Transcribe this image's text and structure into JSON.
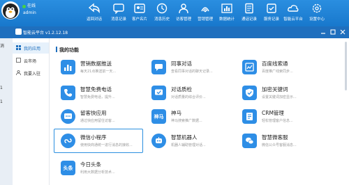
{
  "user": {
    "status": "在线",
    "name": "admin"
  },
  "toolbar": [
    {
      "label": "返回对话",
      "icon": "back-arrow-icon"
    },
    {
      "label": "消息记录",
      "icon": "chat-bubble-icon"
    },
    {
      "label": "客户名片",
      "icon": "id-card-icon"
    },
    {
      "label": "消息历史",
      "icon": "clock-icon"
    },
    {
      "label": "访客管理",
      "icon": "user-manage-icon"
    },
    {
      "label": "营销管理",
      "icon": "signal-icon"
    },
    {
      "label": "数据统计",
      "icon": "bar-chart-icon"
    },
    {
      "label": "通话记录",
      "icon": "document-icon"
    },
    {
      "label": "服务记录",
      "icon": "service-icon"
    },
    {
      "label": "智能云平台",
      "icon": "cloud-platform-icon"
    },
    {
      "label": "设置中心",
      "icon": "gear-icon"
    }
  ],
  "window": {
    "title": "智能云平台 v1.2.12.18"
  },
  "left_sliver": [
    "消",
    "1",
    "1"
  ],
  "sidebar": {
    "items": [
      {
        "label": "我的应用",
        "icon": "grid-icon"
      },
      {
        "label": "云市场",
        "icon": "cloud-icon"
      },
      {
        "label": "我要入驻",
        "icon": "user-join-icon"
      }
    ]
  },
  "main": {
    "section_title": "我的功能",
    "cards": [
      {
        "title": "营销数据推送",
        "desc": "每天21点推送前一天...",
        "icon": "bar-chart-icon",
        "icon_text": ""
      },
      {
        "title": "同事对话",
        "desc": "查看同事对话的聊天记录...",
        "icon": "colleague-chat-icon",
        "icon_text": ""
      },
      {
        "title": "百度线索通",
        "desc": "百度推广线索同步...",
        "icon": "baidu-clue-icon",
        "icon_text": ""
      },
      {
        "title": "智慧免费电话",
        "desc": "智慧免费电话，提升...",
        "icon": "phone-icon",
        "icon_text": ""
      },
      {
        "title": "对话质检",
        "desc": "对话质量的综合评价...",
        "icon": "chat-check-icon",
        "icon_text": ""
      },
      {
        "title": "加密关键词",
        "desc": "设置关键词加密显示...",
        "icon": "shield-icon",
        "icon_text": ""
      },
      {
        "title": "留客快应用",
        "desc": "通过快应用留住访客...",
        "icon": "app-icon",
        "icon_text": ""
      },
      {
        "title": "神马",
        "desc": "神马搜索推广数据...",
        "icon": "shenma-icon",
        "icon_text": "神马"
      },
      {
        "title": "CRM管理",
        "desc": "轻松管理客户信息...",
        "icon": "crm-icon",
        "icon_text": ""
      },
      {
        "title": "微信小程序",
        "desc": "使用快商通统一进行消息的接收...",
        "icon": "mini-program-icon",
        "icon_text": ""
      },
      {
        "title": "智慧机器人",
        "desc": "机器人辅助管理对话...",
        "icon": "robot-icon",
        "icon_text": ""
      },
      {
        "title": "智慧微客服",
        "desc": "微信公众号客服消息...",
        "icon": "wechat-service-icon",
        "icon_text": ""
      },
      {
        "title": "今日头条",
        "desc": "利用大数据分析技术...",
        "icon": "toutiao-icon",
        "icon_text": "头条"
      }
    ]
  },
  "colors": {
    "brand_blue": "#1f6fbe",
    "icon_blue": "#2e8ee6",
    "selected_border": "#2b8fe0"
  }
}
